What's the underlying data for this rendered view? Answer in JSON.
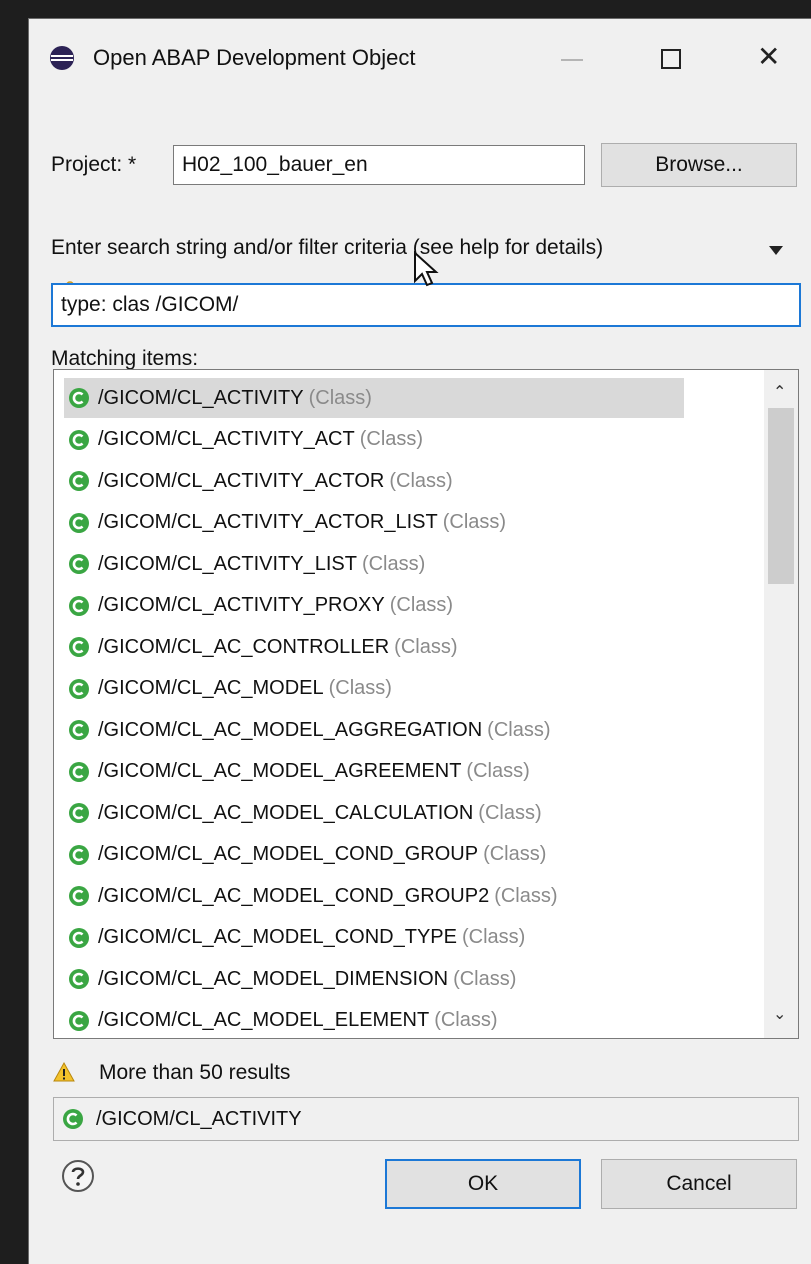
{
  "window": {
    "title": "Open ABAP Development Object",
    "icon": "eclipse-icon"
  },
  "project": {
    "label": "Project: *",
    "value": "H02_100_bauer_en",
    "browse_label": "Browse..."
  },
  "search": {
    "label": "Enter search string and/or filter criteria (see help for details)",
    "value": "type: clas /GICOM/"
  },
  "matching": {
    "label": "Matching items:",
    "items": [
      {
        "name": "/GICOM/CL_ACTIVITY",
        "kind": "(Class)"
      },
      {
        "name": "/GICOM/CL_ACTIVITY_ACT",
        "kind": "(Class)"
      },
      {
        "name": "/GICOM/CL_ACTIVITY_ACTOR",
        "kind": "(Class)"
      },
      {
        "name": "/GICOM/CL_ACTIVITY_ACTOR_LIST",
        "kind": "(Class)"
      },
      {
        "name": "/GICOM/CL_ACTIVITY_LIST",
        "kind": "(Class)"
      },
      {
        "name": "/GICOM/CL_ACTIVITY_PROXY",
        "kind": "(Class)"
      },
      {
        "name": "/GICOM/CL_AC_CONTROLLER",
        "kind": "(Class)"
      },
      {
        "name": "/GICOM/CL_AC_MODEL",
        "kind": "(Class)"
      },
      {
        "name": "/GICOM/CL_AC_MODEL_AGGREGATION",
        "kind": "(Class)"
      },
      {
        "name": "/GICOM/CL_AC_MODEL_AGREEMENT",
        "kind": "(Class)"
      },
      {
        "name": "/GICOM/CL_AC_MODEL_CALCULATION",
        "kind": "(Class)"
      },
      {
        "name": "/GICOM/CL_AC_MODEL_COND_GROUP",
        "kind": "(Class)"
      },
      {
        "name": "/GICOM/CL_AC_MODEL_COND_GROUP2",
        "kind": "(Class)"
      },
      {
        "name": "/GICOM/CL_AC_MODEL_COND_TYPE",
        "kind": "(Class)"
      },
      {
        "name": "/GICOM/CL_AC_MODEL_DIMENSION",
        "kind": "(Class)"
      },
      {
        "name": "/GICOM/CL_AC_MODEL_ELEMENT",
        "kind": "(Class)"
      }
    ]
  },
  "status": {
    "message": "More than 50 results",
    "icon": "warning-icon"
  },
  "selection": {
    "value": "/GICOM/CL_ACTIVITY"
  },
  "buttons": {
    "ok_label": "OK",
    "cancel_label": "Cancel"
  },
  "colors": {
    "class_icon": "#3aa643",
    "focus_border": "#1c78d6",
    "selected_row": "#d9d9d9"
  }
}
